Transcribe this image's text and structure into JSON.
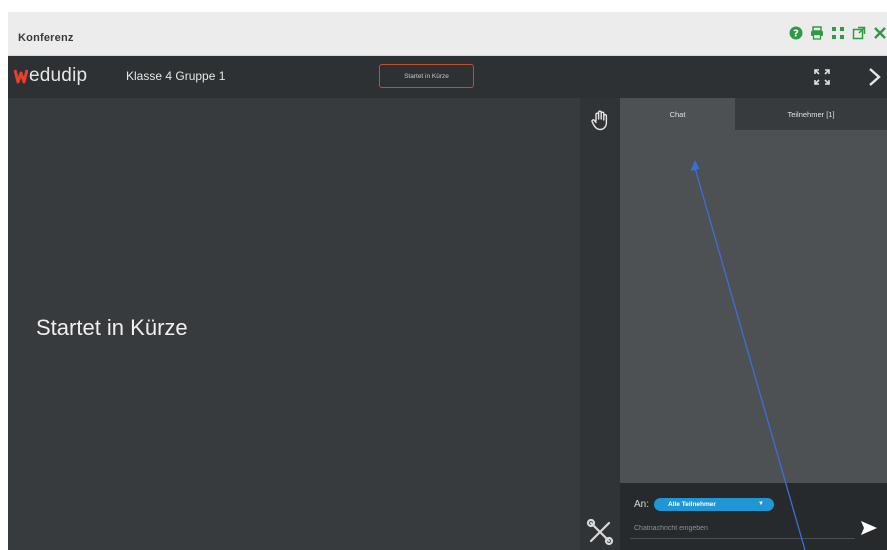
{
  "window": {
    "title": "Konferenz",
    "icons": [
      "help-icon",
      "print-icon",
      "fullscreen-icon",
      "popout-icon",
      "close-icon"
    ]
  },
  "app": {
    "logo_text": "edudip",
    "room_name": "Klasse 4 Gruppe 1",
    "status_pill": "Startet in Kürze",
    "brand_color": "#e8402a"
  },
  "stage": {
    "message": "Startet in Kürze"
  },
  "panel": {
    "tabs": [
      {
        "label": "Chat",
        "active": true
      },
      {
        "label": "Teilnehmer [1]",
        "active": false
      }
    ],
    "compose": {
      "to_label": "An:",
      "recipient": "Alle Teilnehmer",
      "input_placeholder": "Chatnachricht eingeben"
    }
  },
  "colors": {
    "accent_blue": "#2196d4",
    "annotation_arrow": "#3b6fd8"
  }
}
